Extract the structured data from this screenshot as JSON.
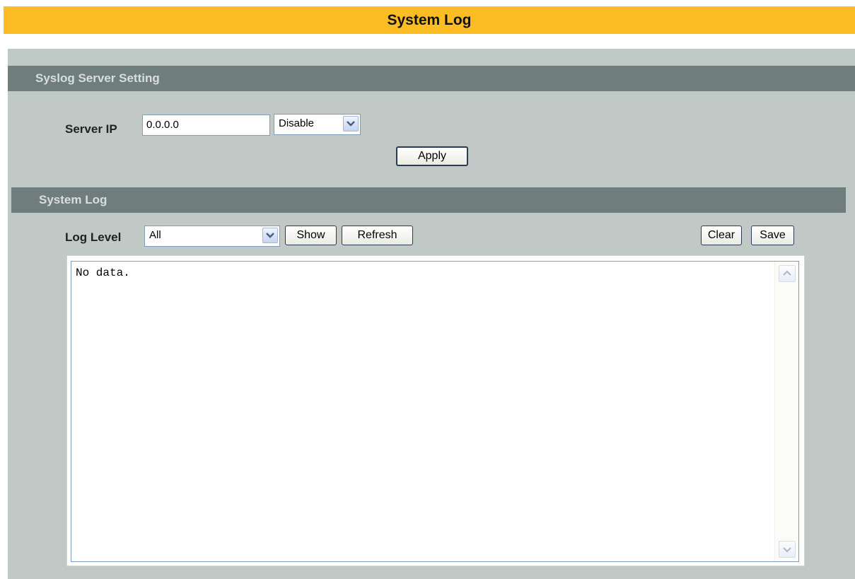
{
  "page": {
    "title": "System Log"
  },
  "syslog_section": {
    "title": "Syslog Server Setting",
    "server_ip_label": "Server IP",
    "server_ip_value": "0.0.0.0",
    "mode_selected": "Disable",
    "apply_label": "Apply"
  },
  "log_section": {
    "title": "System Log",
    "log_level_label": "Log Level",
    "log_level_selected": "All",
    "show_label": "Show",
    "refresh_label": "Refresh",
    "clear_label": "Clear",
    "save_label": "Save",
    "log_content": "No data."
  },
  "icons": {
    "dropdown": "chevron-down-icon",
    "scroll_up": "scroll-up-arrow-icon",
    "scroll_down": "scroll-down-arrow-icon"
  },
  "colors": {
    "header_bar": "#fbbd23",
    "panel_bg": "#c1c9c7",
    "section_bar": "#6f7d7c"
  }
}
